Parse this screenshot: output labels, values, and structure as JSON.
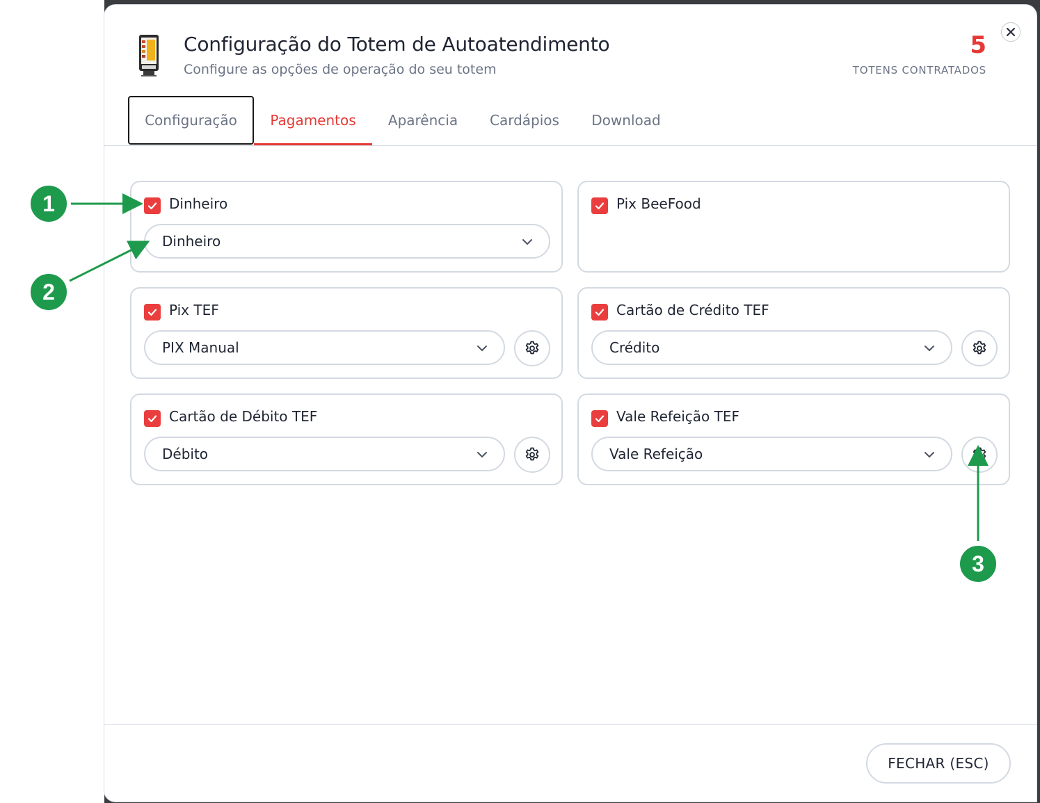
{
  "header": {
    "title": "Configuração do Totem de Autoatendimento",
    "subtitle": "Configure as opções de operação do seu totem",
    "count": "5",
    "count_label": "TOTENS CONTRATADOS",
    "close_icon": "close-icon",
    "device_icon": "kiosk-icon"
  },
  "tabs": [
    {
      "label": "Configuração",
      "state": "focused"
    },
    {
      "label": "Pagamentos",
      "state": "active"
    },
    {
      "label": "Aparência",
      "state": "normal"
    },
    {
      "label": "Cardápios",
      "state": "normal"
    },
    {
      "label": "Download",
      "state": "normal"
    }
  ],
  "payments": [
    {
      "label": "Dinheiro",
      "checked": true,
      "select": "Dinheiro",
      "has_settings": false
    },
    {
      "label": "Pix BeeFood",
      "checked": true,
      "select": null,
      "has_settings": false
    },
    {
      "label": "Pix TEF",
      "checked": true,
      "select": "PIX Manual",
      "has_settings": true
    },
    {
      "label": "Cartão de Crédito TEF",
      "checked": true,
      "select": "Crédito",
      "has_settings": true
    },
    {
      "label": "Cartão de Débito TEF",
      "checked": true,
      "select": "Débito",
      "has_settings": true
    },
    {
      "label": "Vale Refeição TEF",
      "checked": true,
      "select": "Vale Refeição",
      "has_settings": true
    }
  ],
  "footer": {
    "close_label": "FECHAR (ESC)"
  },
  "annotations": [
    "1",
    "2",
    "3"
  ],
  "colors": {
    "accent": "#e53935",
    "checkbox": "#ea3e3e",
    "annotation": "#1e9a4d",
    "border": "#d3d9e2"
  }
}
